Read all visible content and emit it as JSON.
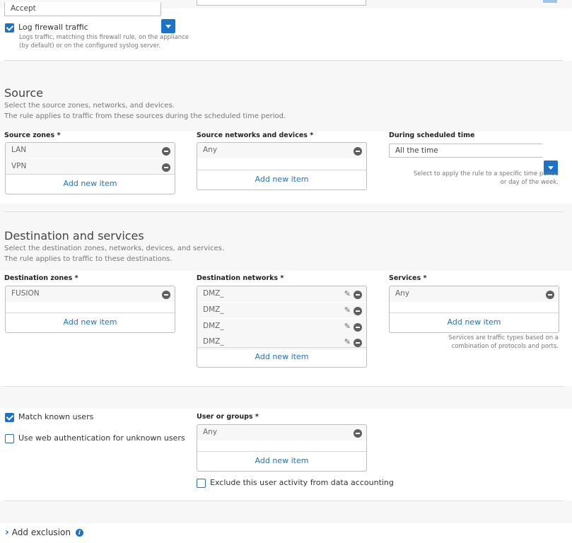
{
  "top": {
    "action_value": "Accept",
    "log_traffic_label": "Log firewall traffic",
    "log_traffic_checked": true,
    "log_traffic_help": "Logs traffic, matching this firewall rule, on the appliance (by default) or on the configured syslog server."
  },
  "source": {
    "title": "Source",
    "desc_1": "Select the source zones, networks, and devices.",
    "desc_2": "The rule applies to traffic from these sources during the scheduled time period.",
    "zones_label": "Source zones",
    "zones": [
      "LAN",
      "VPN"
    ],
    "networks_label": "Source networks and devices",
    "networks": [
      "Any"
    ],
    "schedule_label": "During scheduled time",
    "schedule_value": "All the time",
    "schedule_help": "Select to apply the rule to a specific time period or day of the week."
  },
  "destination": {
    "title": "Destination and services",
    "desc_1": "Select the destination zones, networks, devices, and services.",
    "desc_2": "The rule applies to traffic to these destinations.",
    "zones_label": "Destination zones",
    "zones": [
      "FUSION"
    ],
    "networks_label": "Destination networks",
    "networks": [
      "DMZ_",
      "DMZ_",
      "DMZ_",
      "DMZ_"
    ],
    "services_label": "Services",
    "services": [
      "Any"
    ],
    "services_help": "Services are traffic types based on a combination of protocols and ports."
  },
  "users": {
    "match_known_label": "Match known users",
    "match_known_checked": true,
    "web_auth_label": "Use web authentication for unknown users",
    "web_auth_checked": false,
    "groups_label": "User or groups",
    "groups": [
      "Any"
    ],
    "exclude_label": "Exclude this user activity from data accounting",
    "exclude_checked": false
  },
  "common": {
    "required_mark": "*",
    "add_new_item": "Add new item"
  },
  "exclusion": {
    "label": "Add exclusion",
    "chevron": "›",
    "info": "i"
  },
  "icons": {
    "checkbox": "check-icon",
    "remove": "minus-circle-icon",
    "edit": "pencil-icon",
    "dropdown": "chevron-down-icon",
    "pencil_glyph": "✎"
  },
  "colors": {
    "accent": "#1a73c9",
    "band": "#f7f7f7"
  }
}
